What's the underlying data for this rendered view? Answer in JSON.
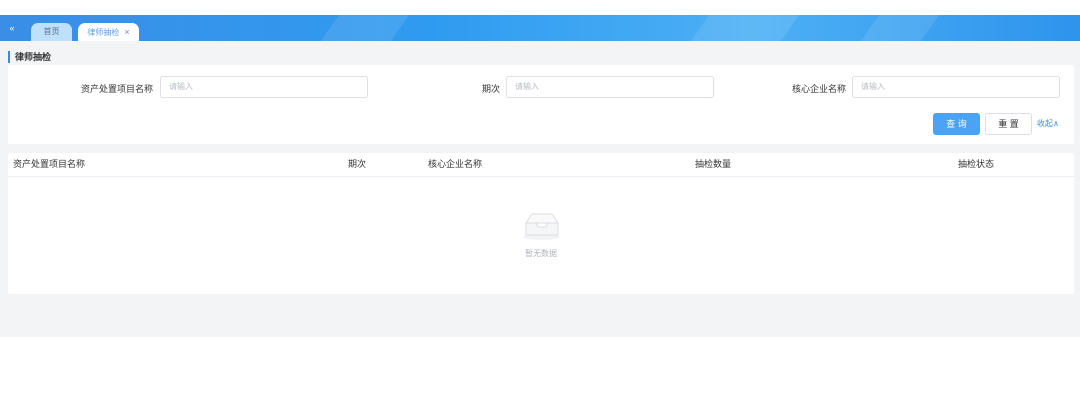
{
  "header": {
    "collapse_icon": "double-chevron-left-icon",
    "tabs": [
      {
        "label": "首页",
        "closable": false,
        "active": false
      },
      {
        "label": "律师抽检",
        "closable": true,
        "active": true,
        "close_glyph": "×"
      }
    ],
    "brand_color": "#2f9bf0"
  },
  "page": {
    "title": "律师抽检"
  },
  "search": {
    "fields": [
      {
        "label": "资产处置项目名称",
        "placeholder": "请输入",
        "value": ""
      },
      {
        "label": "期次",
        "placeholder": "请输入",
        "value": ""
      },
      {
        "label": "核心企业名称",
        "placeholder": "请输入",
        "value": ""
      }
    ],
    "query_label": "查 询",
    "reset_label": "重 置",
    "collapse_label": "收起∧"
  },
  "table": {
    "columns": [
      "资产处置项目名称",
      "期次",
      "核心企业名称",
      "抽检数量",
      "抽检状态"
    ],
    "rows": [],
    "empty_text": "暂无数据",
    "empty_icon": "empty-box-icon"
  }
}
